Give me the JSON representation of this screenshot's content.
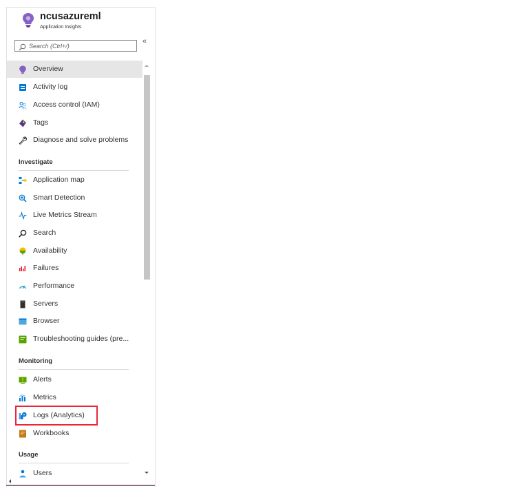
{
  "header": {
    "title": "ncusazureml",
    "subtitle": "Application Insights"
  },
  "search": {
    "placeholder": "Search (Ctrl+/)",
    "value": ""
  },
  "nav": {
    "top": [
      {
        "label": "Overview",
        "icon": "overview-icon",
        "active": true
      },
      {
        "label": "Activity log",
        "icon": "activity-log-icon"
      },
      {
        "label": "Access control (IAM)",
        "icon": "access-control-icon"
      },
      {
        "label": "Tags",
        "icon": "tag-icon"
      },
      {
        "label": "Diagnose and solve problems",
        "icon": "wrench-icon"
      }
    ],
    "investigate": {
      "title": "Investigate",
      "items": [
        {
          "label": "Application map",
          "icon": "application-map-icon"
        },
        {
          "label": "Smart Detection",
          "icon": "smart-detection-icon"
        },
        {
          "label": "Live Metrics Stream",
          "icon": "live-metrics-icon"
        },
        {
          "label": "Search",
          "icon": "search-icon"
        },
        {
          "label": "Availability",
          "icon": "availability-icon"
        },
        {
          "label": "Failures",
          "icon": "failures-icon"
        },
        {
          "label": "Performance",
          "icon": "performance-icon"
        },
        {
          "label": "Servers",
          "icon": "servers-icon"
        },
        {
          "label": "Browser",
          "icon": "browser-icon"
        },
        {
          "label": "Troubleshooting guides (pre...",
          "icon": "troubleshooting-icon"
        }
      ]
    },
    "monitoring": {
      "title": "Monitoring",
      "items": [
        {
          "label": "Alerts",
          "icon": "alerts-icon"
        },
        {
          "label": "Metrics",
          "icon": "metrics-icon"
        },
        {
          "label": "Logs (Analytics)",
          "icon": "logs-icon",
          "highlighted": true
        },
        {
          "label": "Workbooks",
          "icon": "workbooks-icon"
        }
      ]
    },
    "usage": {
      "title": "Usage",
      "items": [
        {
          "label": "Users",
          "icon": "users-icon"
        }
      ]
    }
  },
  "colors": {
    "active_bg": "#e6e6e6",
    "highlight_border": "#e8283a",
    "brand_purple": "#8661c5"
  }
}
